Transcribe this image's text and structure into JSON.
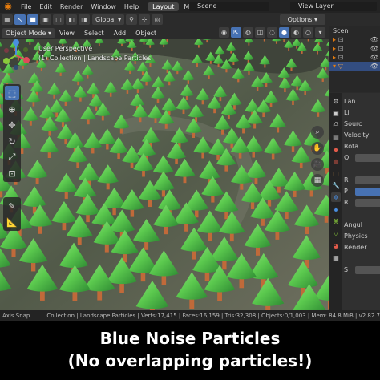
{
  "menubar": {
    "items": [
      "File",
      "Edit",
      "Render",
      "Window",
      "Help"
    ],
    "tabs": [
      "Layout",
      "Mo"
    ],
    "scene": "Scene",
    "view_layer": "View Layer"
  },
  "toolheader": {
    "orientation": "Global",
    "options": "Options"
  },
  "viewheader": {
    "mode": "Object Mode",
    "menus": [
      "View",
      "Select",
      "Add",
      "Object"
    ]
  },
  "viewport": {
    "view_name": "User Perspective",
    "collection": "(1) Collection | Landscape Particles"
  },
  "outliner": {
    "rows": [
      "Scen",
      "",
      "",
      "",
      "",
      ""
    ]
  },
  "properties": {
    "rows": [
      "Lan",
      "Li",
      "Sourc",
      "Velocity",
      "Rota",
      "O",
      "",
      "R",
      "P",
      "R",
      "",
      "Angul",
      "Physics",
      "Render",
      "",
      "S",
      ""
    ]
  },
  "statusbar": {
    "left": "Axis Snap",
    "stats": "Collection | Landscape Particles | Verts:17,415 | Faces:16,159 | Tris:32,308 | Objects:0/1,003 | Mem: 84.8 MiB | v2.82.7"
  },
  "caption": {
    "line1": "Blue Noise Particles",
    "line2": "(No overlapping particles!)"
  },
  "colors": {
    "accent": "#4772b3",
    "tree_green": "#5fcf55",
    "tree_trunk": "#c06a3a",
    "ground": "#5b6552"
  }
}
